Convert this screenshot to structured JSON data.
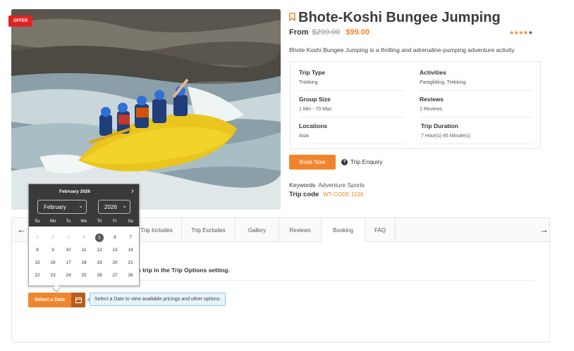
{
  "offer_badge": "OFFER",
  "trip": {
    "title": "Bhote-Koshi Bungee Jumping",
    "price_from": "From",
    "price_old": "$299.00",
    "price_new": "$99.00",
    "rating_stars": 4,
    "rating_max": 5,
    "description": "Bhote Koshi Bungee Jumping is a thrilling and adrenaline-pumping adventure activity."
  },
  "facts": {
    "trip_type": {
      "label": "Trip Type",
      "value": "Trekking"
    },
    "activities": {
      "label": "Activities",
      "value": "Paragliding, Trekking"
    },
    "group_size": {
      "label": "Group Size",
      "value": "1 Min - 70 Max"
    },
    "reviews": {
      "label": "Reviews",
      "value": "1 Reviews"
    },
    "locations": {
      "label": "Locations",
      "value": "Asia"
    },
    "duration": {
      "label": "Trip Duration",
      "value": "7 Hour(s) 45 Minute(s)"
    }
  },
  "actions": {
    "book_now": "Book Now",
    "trip_enquiry": "Trip Enquiry"
  },
  "keywords": {
    "label": "Keywords",
    "value": "Adventure Sports"
  },
  "trip_code": {
    "label": "Trip code",
    "value": "WT-CODE 1136"
  },
  "tabs": [
    "Trip Includes",
    "Trip Excludes",
    "Gallery",
    "Reviews",
    "Booking",
    "FAQ"
  ],
  "active_tab": "Booking",
  "booking": {
    "notice_visible": "s trip in the Trip Options setting.",
    "select_date": "Select a Date",
    "hint": "Select a Date to view available pricings and other options."
  },
  "datepicker": {
    "title": "February 2026",
    "month_select": "February",
    "year_select": "2026",
    "weekdays": [
      "Su",
      "Mo",
      "Tu",
      "We",
      "Th",
      "Fr",
      "Sa"
    ],
    "weeks": [
      [
        {
          "d": "1",
          "dim": true
        },
        {
          "d": "2",
          "dim": true
        },
        {
          "d": "3",
          "dim": true
        },
        {
          "d": "4",
          "dim": true
        },
        {
          "d": "5",
          "today": true
        },
        {
          "d": "6"
        },
        {
          "d": "7"
        }
      ],
      [
        {
          "d": "8"
        },
        {
          "d": "9"
        },
        {
          "d": "10"
        },
        {
          "d": "11"
        },
        {
          "d": "12"
        },
        {
          "d": "13"
        },
        {
          "d": "14"
        }
      ],
      [
        {
          "d": "15"
        },
        {
          "d": "16"
        },
        {
          "d": "17"
        },
        {
          "d": "18"
        },
        {
          "d": "19"
        },
        {
          "d": "20"
        },
        {
          "d": "21"
        }
      ],
      [
        {
          "d": "22"
        },
        {
          "d": "23"
        },
        {
          "d": "24"
        },
        {
          "d": "25"
        },
        {
          "d": "26"
        },
        {
          "d": "27"
        },
        {
          "d": "28"
        }
      ]
    ]
  },
  "colors": {
    "accent": "#f0852d",
    "badge": "#e02424",
    "picker_header": "#3a3a3a"
  }
}
